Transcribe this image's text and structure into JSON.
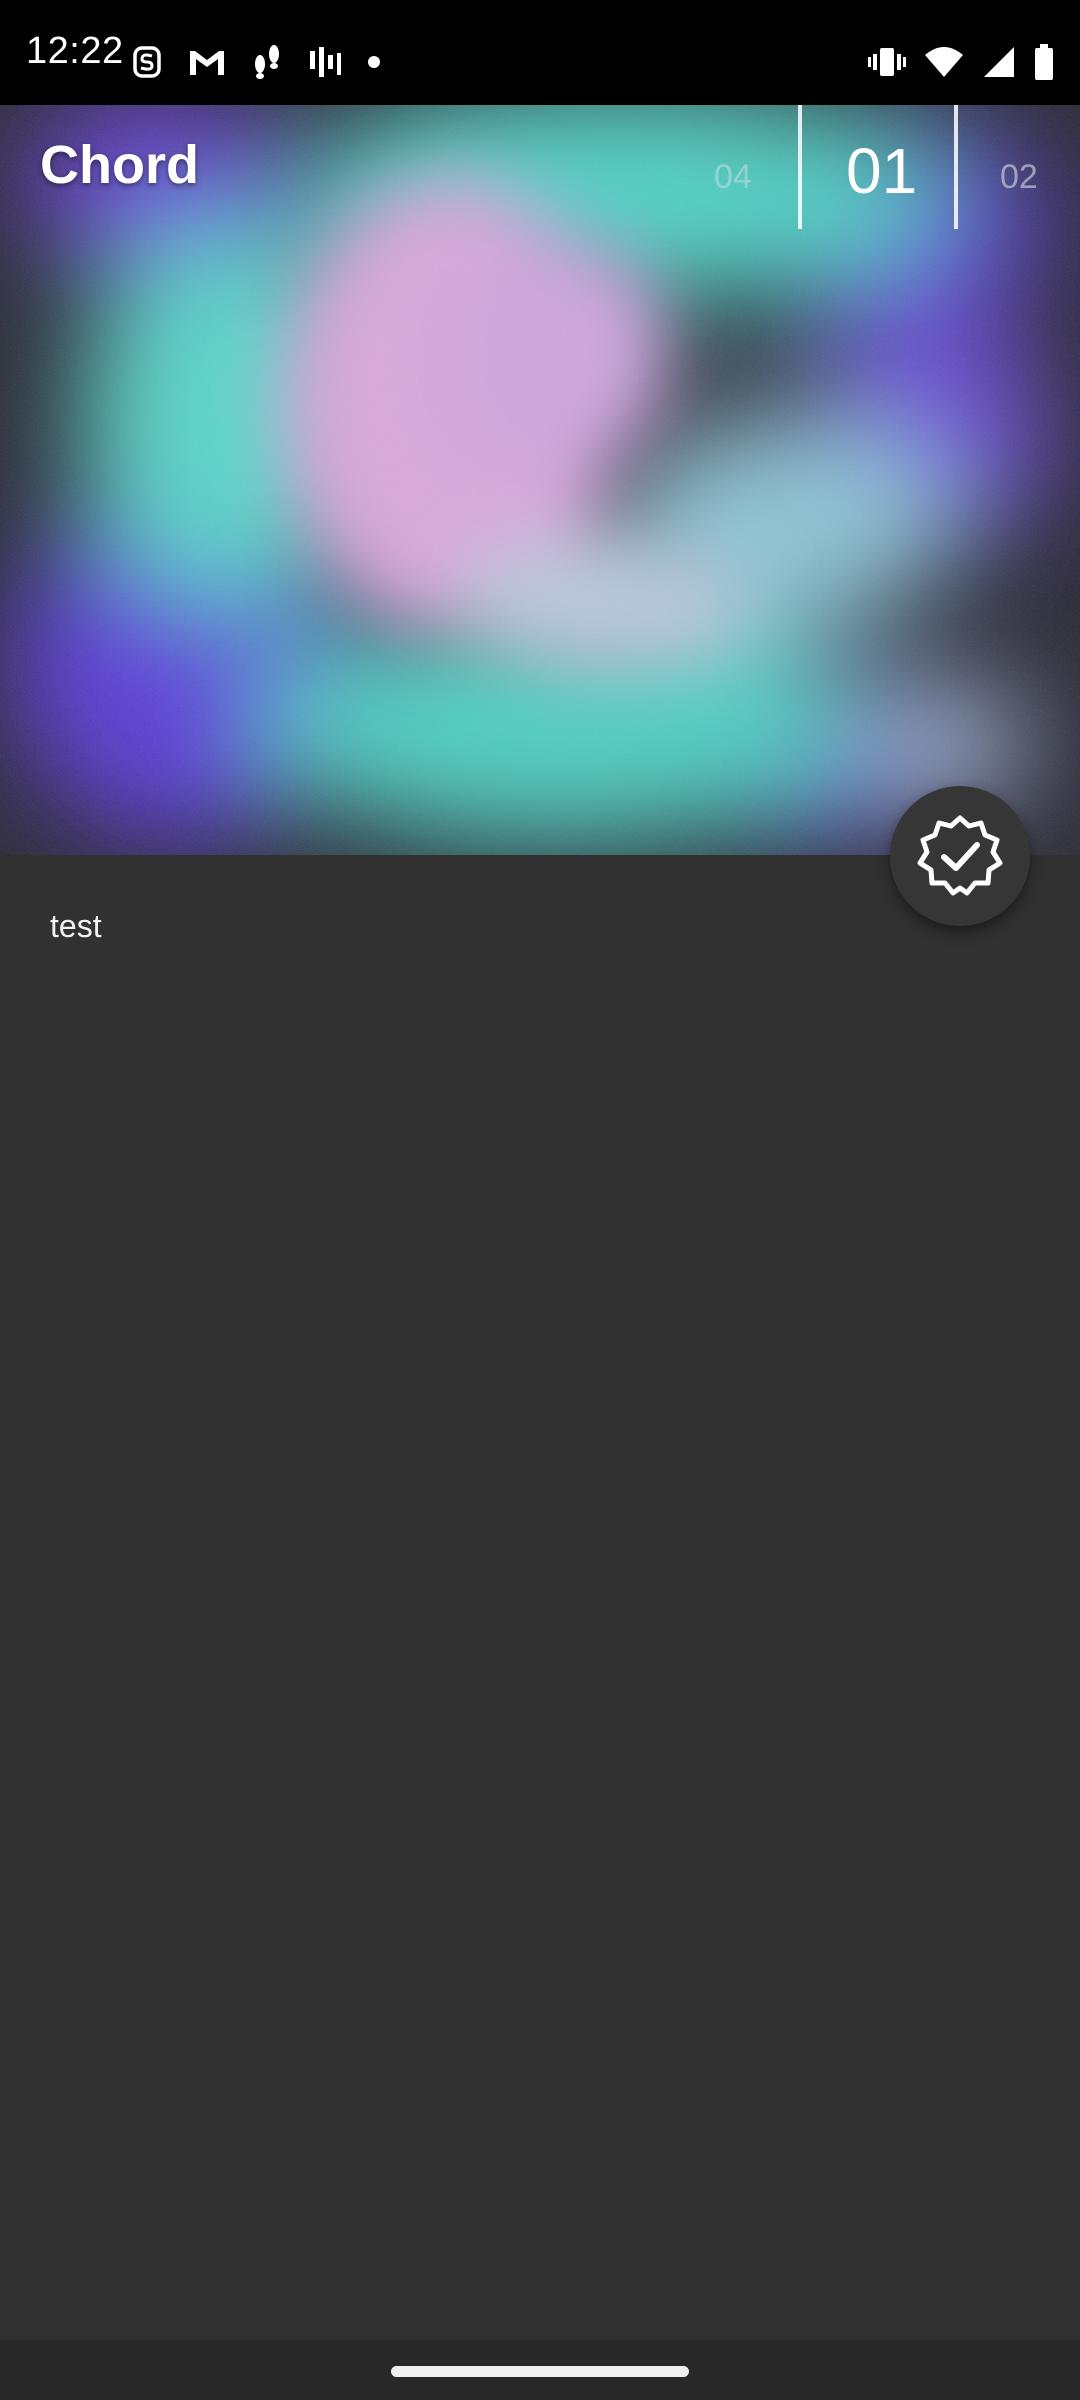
{
  "status_bar": {
    "time": "12:22",
    "left_icons": [
      "streaks-icon",
      "gmail-icon",
      "footsteps-icon",
      "activity-bars-icon",
      "notification-dot-icon"
    ],
    "right_icons": [
      "vibrate-icon",
      "wifi-icon",
      "cell-signal-icon",
      "battery-icon"
    ]
  },
  "header": {
    "title": "Chord",
    "tabs": {
      "previous": "04",
      "current": "01",
      "next": "02"
    }
  },
  "hero": {
    "colors": [
      "#1e1c2c",
      "#5a3bd8",
      "#4fd4c6",
      "#d8a8dc"
    ]
  },
  "fab": {
    "icon": "verified-check-icon"
  },
  "note": {
    "text": "test"
  }
}
